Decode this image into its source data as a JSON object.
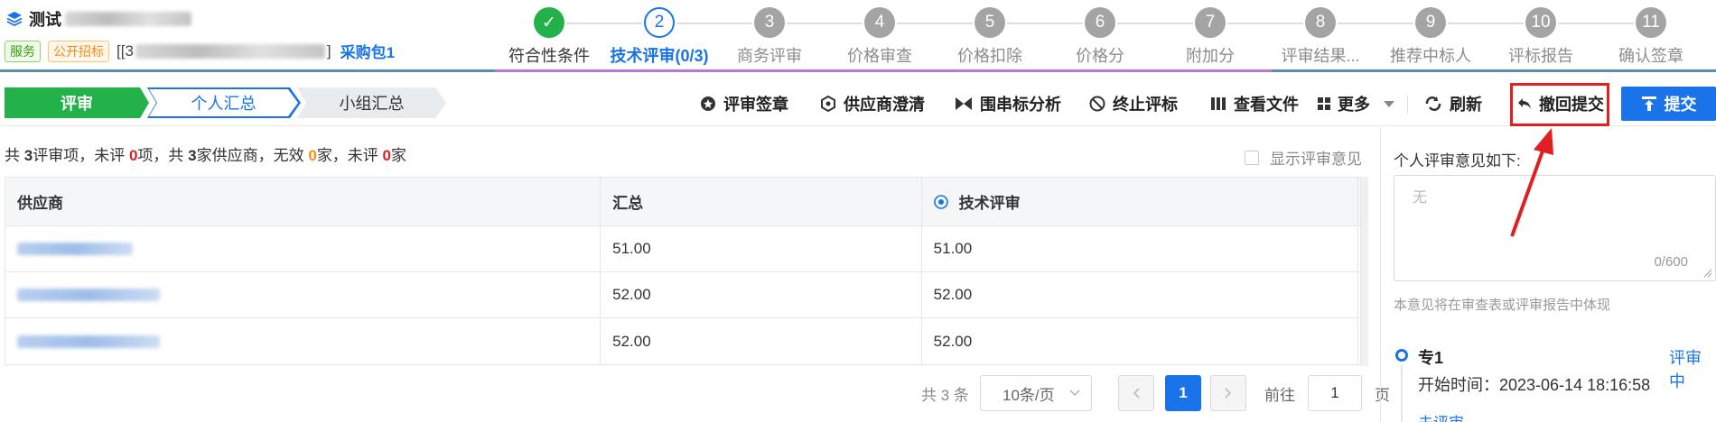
{
  "header": {
    "title_prefix": "测试",
    "tags": [
      "服务",
      "公开招标"
    ],
    "code_prefix": "[[3",
    "code_suffix": "]",
    "package_link": "采购包1"
  },
  "steps": [
    {
      "num": "✓",
      "label": "符合性条件",
      "state": "done"
    },
    {
      "num": "2",
      "label": "技术评审(0/3)",
      "state": "active"
    },
    {
      "num": "3",
      "label": "商务评审",
      "state": "todo"
    },
    {
      "num": "4",
      "label": "价格审查",
      "state": "todo"
    },
    {
      "num": "5",
      "label": "价格扣除",
      "state": "todo"
    },
    {
      "num": "6",
      "label": "价格分",
      "state": "todo"
    },
    {
      "num": "7",
      "label": "附加分",
      "state": "todo"
    },
    {
      "num": "8",
      "label": "评审结果...",
      "state": "todo"
    },
    {
      "num": "9",
      "label": "推荐中标人",
      "state": "todo"
    },
    {
      "num": "10",
      "label": "评标报告",
      "state": "todo"
    },
    {
      "num": "11",
      "label": "确认签章",
      "state": "todo"
    }
  ],
  "subtabs": [
    "评审",
    "个人汇总",
    "小组汇总"
  ],
  "toolbar": {
    "sign": "评审签章",
    "clarify": "供应商澄清",
    "collusion": "围串标分析",
    "terminate": "终止评标",
    "view_files": "查看文件",
    "more": "更多",
    "refresh": "刷新",
    "withdraw": "撤回提交",
    "submit": "提交"
  },
  "summary": {
    "p1": "共 ",
    "items": "3",
    "p2": "评审项，未评 ",
    "unrated_items": "0",
    "p3": "项，共 ",
    "suppliers": "3",
    "p4": "家供应商，无效 ",
    "invalid": "0",
    "p5": "家，未评 ",
    "unrated_suppliers": "0",
    "p6": "家"
  },
  "show_opinion_label": "显示评审意见",
  "table": {
    "headers": [
      "供应商",
      "汇总",
      "技术评审"
    ],
    "rows": [
      {
        "total": "51.00",
        "tech": "51.00"
      },
      {
        "total": "52.00",
        "tech": "52.00"
      },
      {
        "total": "52.00",
        "tech": "52.00"
      }
    ]
  },
  "pager": {
    "total": "共 3 条",
    "page_size": "10条/页",
    "current": "1",
    "goto_prefix": "前往",
    "goto_value": "1",
    "goto_suffix": "页"
  },
  "right_panel": {
    "title": "个人评审意见如下:",
    "placeholder": "无",
    "counter": "0/600",
    "note": "本意见将在审查表或评审报告中体现",
    "expert_name": "专1",
    "expert_status": "评审中",
    "start_time": "开始时间：2023-06-14 18:16:58",
    "cut_text": "未评审"
  },
  "colors": {
    "primary": "#1a73e8",
    "success": "#23b24a",
    "highlight": "#e02020",
    "purple": "#b57ad6"
  }
}
